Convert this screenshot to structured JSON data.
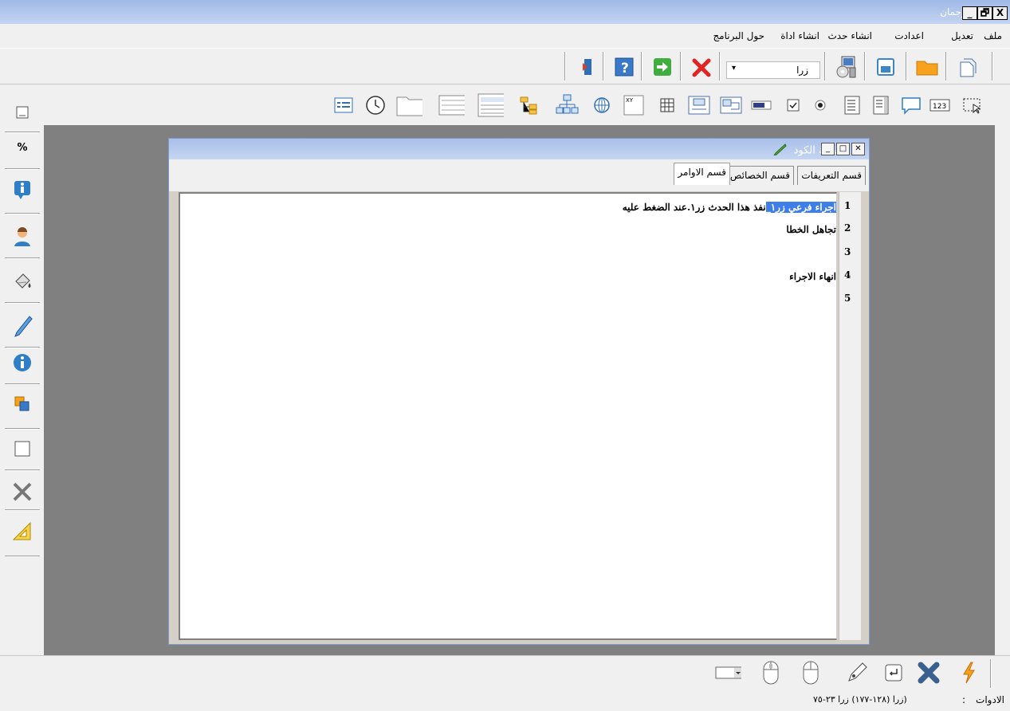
{
  "window": {
    "title": "ترجمان",
    "close_label": "X",
    "restore_label": "🗗",
    "min_label": "_"
  },
  "menu": {
    "items": [
      {
        "label": "ملف"
      },
      {
        "label": "تعديل"
      },
      {
        "label": "اعدادت"
      },
      {
        "label": "انشاء حدث"
      },
      {
        "label": "انشاء اداة"
      },
      {
        "label": "حول البرنامج"
      }
    ]
  },
  "toolbar": {
    "combo_value": "زرا"
  },
  "code_window": {
    "title": "صفحة الكود",
    "tabs": [
      {
        "label": "قسم التعريفات"
      },
      {
        "label": "قسم الخصائص"
      },
      {
        "label": "قسم الاوامر"
      }
    ],
    "lines": [
      {
        "number": "1",
        "highlight": "اجراء فرعي زر١_",
        "text": "نفذ هذا الحدث زر١.عند الضغط عليه"
      },
      {
        "number": "2",
        "highlight": "",
        "text": "تجاهل الخطا"
      },
      {
        "number": "3",
        "highlight": "",
        "text": ""
      },
      {
        "number": "4",
        "highlight": "",
        "text": "انهاء الاجراء"
      },
      {
        "number": "5",
        "highlight": "",
        "text": ""
      }
    ]
  },
  "status": {
    "label": "الادوات",
    "colon": ":",
    "value": "زرا  (١٢٨-١٧٧) زرا ٢٣-٧٥)"
  },
  "colors": {
    "accent": "#3e7ee8",
    "workspace": "#808080",
    "titlebar": "#b3c8ee"
  }
}
